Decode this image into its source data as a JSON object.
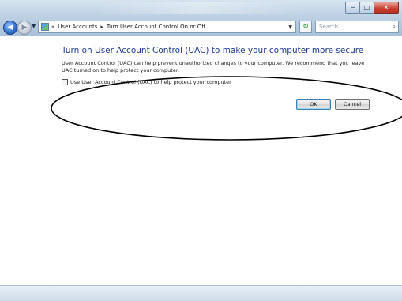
{
  "window": {
    "controls": {
      "minimize": "─",
      "maximize": "□",
      "close": "✕"
    }
  },
  "nav": {
    "back_glyph": "◀",
    "forward_glyph": "▶",
    "dropdown_glyph": "▼",
    "address": {
      "prefix": "«",
      "crumbs": [
        "User Accounts",
        "Turn User Account Control On or Off"
      ],
      "separator": "▸",
      "dropdown_glyph": "▼"
    },
    "refresh_glyph": "↻",
    "search": {
      "placeholder": "Search",
      "icon": "search-icon"
    }
  },
  "main": {
    "heading": "Turn on User Account Control (UAC) to make your computer more secure",
    "description": "User Account Control (UAC) can help prevent unauthorized changes to your computer. We recommend that you leave UAC turned on to help protect your computer.",
    "checkbox": {
      "label": "Use User Account Control (UAC) to help protect your computer",
      "checked": false
    },
    "buttons": {
      "ok": "OK",
      "cancel": "Cancel"
    }
  },
  "icons": {
    "back": "back-arrow-icon",
    "forward": "forward-arrow-icon",
    "control_panel": "control-panel-icon",
    "refresh": "refresh-icon",
    "search": "search-icon"
  },
  "colors": {
    "heading": "#1e3b8a",
    "titlebar": "#c3d5e7",
    "close_button": "#c9402f"
  }
}
